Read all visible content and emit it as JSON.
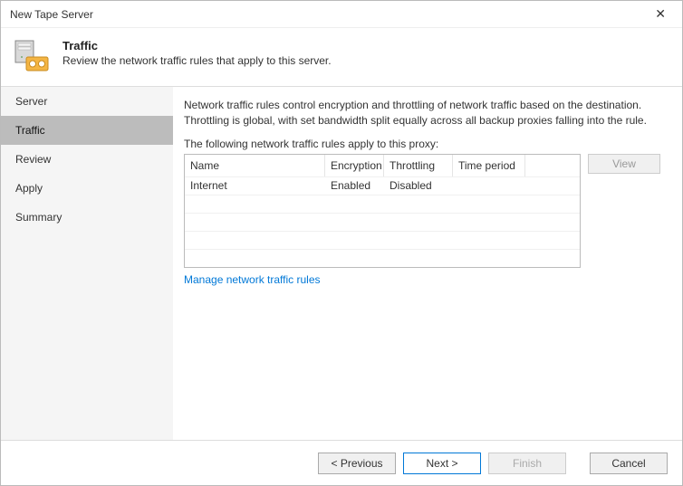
{
  "window": {
    "title": "New Tape Server"
  },
  "header": {
    "title": "Traffic",
    "subtitle": "Review the network traffic rules that apply to this server."
  },
  "sidebar": {
    "items": [
      {
        "label": "Server"
      },
      {
        "label": "Traffic"
      },
      {
        "label": "Review"
      },
      {
        "label": "Apply"
      },
      {
        "label": "Summary"
      }
    ],
    "active_index": 1
  },
  "main": {
    "description": "Network traffic rules control encryption and throttling of network traffic based on the destination. Throttling is global, with set bandwidth split equally across all backup proxies falling into the rule.",
    "list_label": "The following network traffic rules apply to this proxy:",
    "columns": {
      "name": "Name",
      "encryption": "Encryption",
      "throttling": "Throttling",
      "time_period": "Time period"
    },
    "rows": [
      {
        "name": "Internet",
        "encryption": "Enabled",
        "throttling": "Disabled",
        "time_period": ""
      }
    ],
    "view_button": "View",
    "manage_link": "Manage network traffic rules"
  },
  "footer": {
    "previous": "< Previous",
    "next": "Next >",
    "finish": "Finish",
    "cancel": "Cancel"
  }
}
